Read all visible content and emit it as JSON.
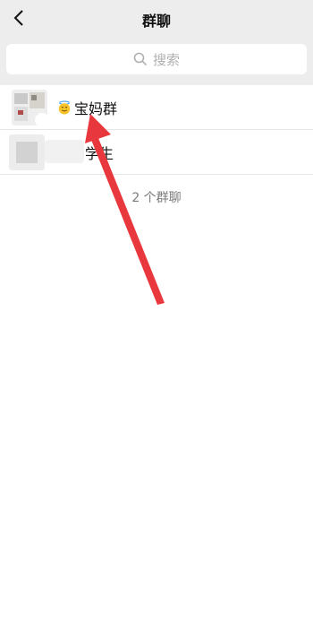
{
  "header": {
    "title": "群聊",
    "back_icon": "chevron-left-icon"
  },
  "search": {
    "placeholder": "搜索",
    "icon": "search-icon"
  },
  "groups": [
    {
      "name": "宝妈群",
      "emoji": "smiling-halo-emoji"
    },
    {
      "name": "学生"
    }
  ],
  "footer": {
    "count_label": "2 个群聊"
  },
  "colors": {
    "header_bg": "#ededed",
    "annotation_arrow": "#e8383d"
  }
}
